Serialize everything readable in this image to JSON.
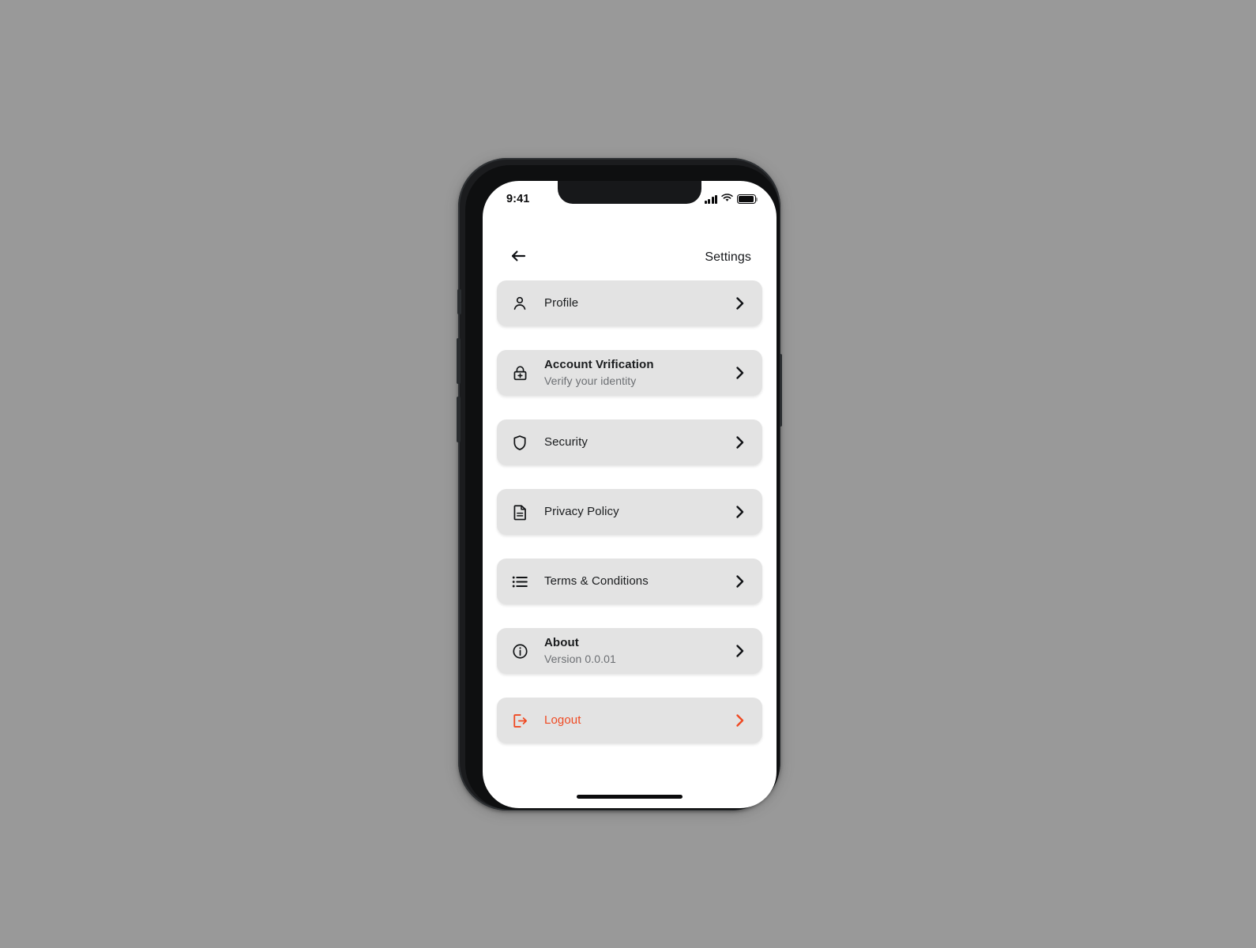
{
  "device": {
    "frame": "iphone-x",
    "bezel_color": "#1b1c1e",
    "screen_bg": "#ffffff",
    "page_bg": "#999999"
  },
  "status_bar": {
    "time": "9:41",
    "cellular_icon": "signal-bars-icon",
    "cellular_bars": 4,
    "wifi_icon": "wifi-icon",
    "battery_icon": "battery-full-icon",
    "battery_level": 100
  },
  "header": {
    "back_icon": "arrow-left-icon",
    "title": "Settings"
  },
  "colors": {
    "card_bg": "#e3e3e3",
    "title_text": "#1a1c1e",
    "sub_text": "#6c6f73",
    "danger": "#ef4a23"
  },
  "settings": {
    "items": [
      {
        "id": "profile",
        "icon": "person-icon",
        "title": "Profile",
        "subtitle": "",
        "chevron": "chevron-right-icon",
        "danger": false
      },
      {
        "id": "account-verification",
        "icon": "lock-plus-icon",
        "title": "Account Vrification",
        "subtitle": "Verify your identity",
        "chevron": "chevron-right-icon",
        "danger": false
      },
      {
        "id": "security",
        "icon": "shield-icon",
        "title": "Security",
        "subtitle": "",
        "chevron": "chevron-right-icon",
        "danger": false
      },
      {
        "id": "privacy-policy",
        "icon": "document-icon",
        "title": "Privacy Policy",
        "subtitle": "",
        "chevron": "chevron-right-icon",
        "danger": false
      },
      {
        "id": "terms-conditions",
        "icon": "list-icon",
        "title": "Terms & Conditions",
        "subtitle": "",
        "chevron": "chevron-right-icon",
        "danger": false
      },
      {
        "id": "about",
        "icon": "info-circle-icon",
        "title": "About",
        "subtitle": "Version 0.0.01",
        "chevron": "chevron-right-icon",
        "danger": false
      },
      {
        "id": "logout",
        "icon": "logout-icon",
        "title": "Logout",
        "subtitle": "",
        "chevron": "chevron-right-icon",
        "danger": true
      }
    ]
  },
  "home_indicator": "home-indicator-bar"
}
